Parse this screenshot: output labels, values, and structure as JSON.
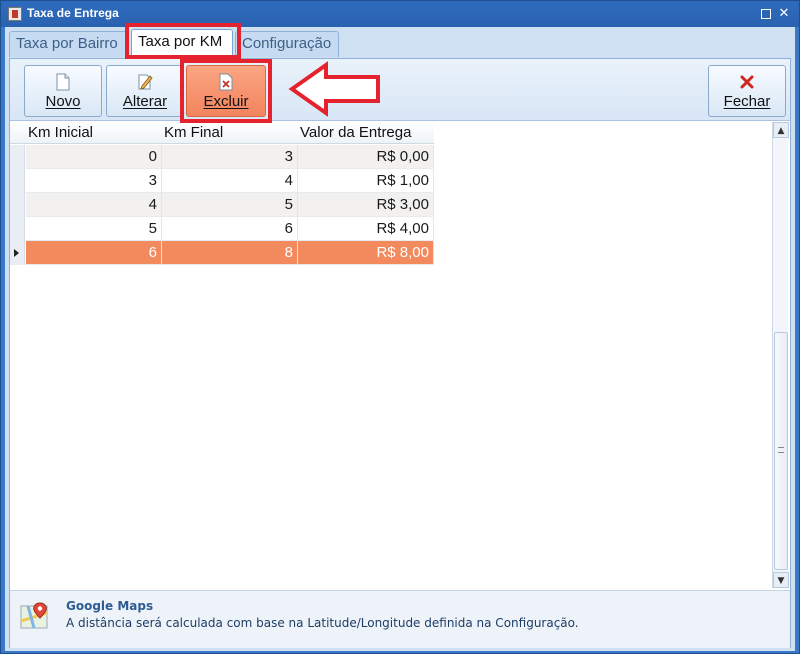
{
  "window": {
    "title": "Taxa de Entrega",
    "maximize_icon": "maximize-icon",
    "close_label": "✕"
  },
  "tabs": [
    {
      "label": "Taxa por Bairro",
      "selected": false
    },
    {
      "label": "Taxa por KM",
      "selected": true
    },
    {
      "label": "Configuração",
      "selected": false
    }
  ],
  "toolbar": {
    "novo_label": "Novo",
    "alterar_label": "Alterar",
    "excluir_label": "Excluir",
    "fechar_label": "Fechar"
  },
  "grid": {
    "columns": [
      "Km Inicial",
      "Km Final",
      "Valor da Entrega"
    ],
    "rows": [
      {
        "km_inicial": "0",
        "km_final": "3",
        "valor": "R$ 0,00"
      },
      {
        "km_inicial": "3",
        "km_final": "4",
        "valor": "R$ 1,00"
      },
      {
        "km_inicial": "4",
        "km_final": "5",
        "valor": "R$ 3,00"
      },
      {
        "km_inicial": "5",
        "km_final": "6",
        "valor": "R$ 4,00"
      },
      {
        "km_inicial": "6",
        "km_final": "8",
        "valor": "R$ 8,00"
      }
    ],
    "selected_row": 4
  },
  "footer": {
    "title": "Google Maps",
    "text": "A distância será calculada com base na Latitude/Longitude definida na Configuração."
  },
  "colors": {
    "selection": "#f28a5e",
    "annotation": "#e5232e",
    "window_chrome": "#3a79c7"
  }
}
